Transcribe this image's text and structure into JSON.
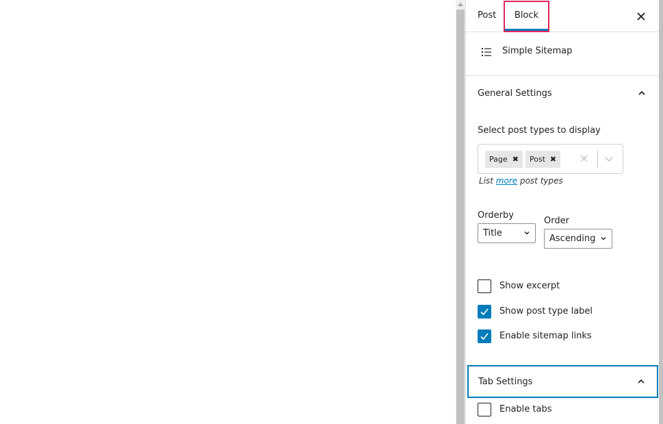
{
  "sidebar": {
    "tabs": [
      {
        "label": "Post",
        "active": false
      },
      {
        "label": "Block",
        "active": true
      }
    ],
    "close_label": "✕",
    "block": {
      "icon": "list-icon",
      "title": "Simple Sitemap"
    },
    "general_settings": {
      "title": "General Settings",
      "expanded": true,
      "post_types_label": "Select post types to display",
      "selected_post_types": [
        "Page",
        "Post"
      ],
      "chip_remove": "✖",
      "clear_all": "✕",
      "help_prefix": "List ",
      "help_link": "more",
      "help_suffix": " post types",
      "orderby_label": "Orderby",
      "orderby_value": "Title",
      "order_label": "Order",
      "order_value": "Ascending",
      "checkboxes": [
        {
          "label": "Show excerpt",
          "checked": false
        },
        {
          "label": "Show post type label",
          "checked": true
        },
        {
          "label": "Enable sitemap links",
          "checked": true
        }
      ]
    },
    "tab_settings": {
      "title": "Tab Settings",
      "expanded": true,
      "checkboxes": [
        {
          "label": "Enable tabs",
          "checked": false
        }
      ]
    }
  },
  "colors": {
    "accent": "#007cba",
    "focus_highlight": "#e2255c"
  }
}
